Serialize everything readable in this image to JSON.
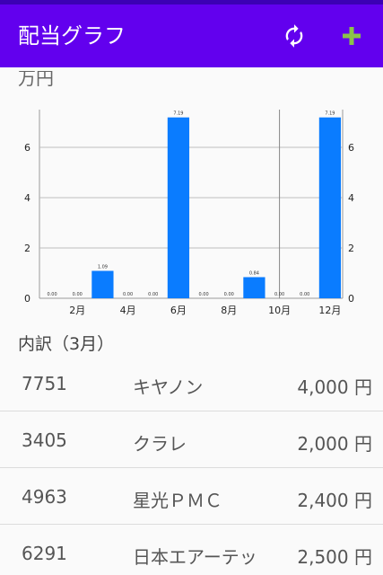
{
  "appbar": {
    "title": "配当グラフ",
    "accent": "#6200ee",
    "add_icon_color": "#8bc34a",
    "icons": [
      "refresh-icon",
      "plus-icon"
    ]
  },
  "chart_data": {
    "type": "bar",
    "unit_label": "万円",
    "categories": [
      "1月",
      "2月",
      "3月",
      "4月",
      "5月",
      "6月",
      "7月",
      "8月",
      "9月",
      "10月",
      "11月",
      "12月"
    ],
    "x_tick_labels": [
      "2月",
      "4月",
      "6月",
      "8月",
      "10月",
      "12月"
    ],
    "values": [
      0,
      0,
      1.09,
      0,
      0,
      7.19,
      0,
      0,
      0.84,
      0,
      0,
      7.19
    ],
    "value_labels": [
      "0.00",
      "0.00",
      "1.09",
      "0.00",
      "0.00",
      "7.19",
      "0.00",
      "0.00",
      "0.84",
      "0.00",
      "0.00",
      "7.19"
    ],
    "ylim": [
      0,
      7.5
    ],
    "yticks": [
      0,
      2,
      4,
      6
    ],
    "bar_color": "#0a7cff",
    "grid": true,
    "highlight_category": "10月"
  },
  "breakdown": {
    "title": "内訳（3月）",
    "rows": [
      {
        "code": "7751",
        "name": "キヤノン",
        "amount": "4,000 円"
      },
      {
        "code": "3405",
        "name": "クラレ",
        "amount": "2,000 円"
      },
      {
        "code": "4963",
        "name": "星光ＰＭＣ",
        "amount": "2,400 円"
      },
      {
        "code": "6291",
        "name": "日本エアーテッ",
        "amount": "2,500 円"
      }
    ]
  }
}
